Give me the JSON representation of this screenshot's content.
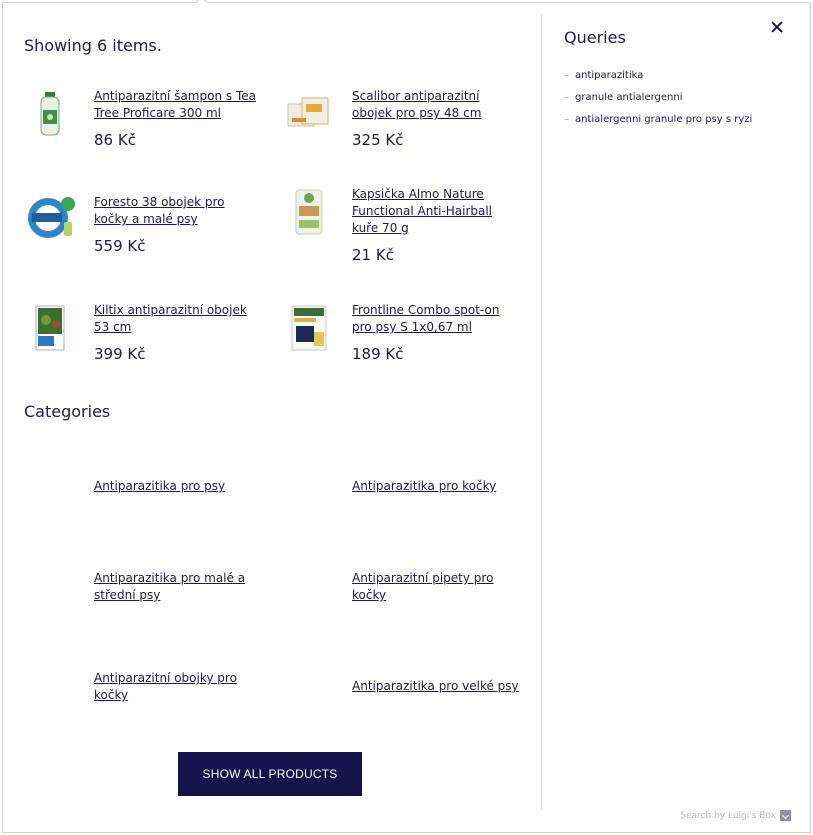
{
  "header": {
    "showing": "Showing 6 items."
  },
  "products": [
    {
      "name": "Antiparazitní šampon s Tea Tree Proficare 300 ml",
      "price": "86 Kč"
    },
    {
      "name": "Scalibor antiparazitní obojek pro psy 48 cm",
      "price": "325 Kč"
    },
    {
      "name": "Foresto 38 obojek pro kočky a malé psy",
      "price": "559 Kč"
    },
    {
      "name": "Kapsička Almo Nature Functional Anti-Hairball kuře 70 g",
      "price": "21 Kč"
    },
    {
      "name": "Kiltix antiparazitní obojek 53 cm",
      "price": "399 Kč"
    },
    {
      "name": "Frontline Combo spot-on pro psy S 1x0,67 ml",
      "price": "189 Kč"
    }
  ],
  "categories": {
    "title": "Categories",
    "items": [
      "Antiparazitika pro psy",
      "Antiparazitika pro kočky",
      "Antiparazitika pro malé a střední psy",
      "Antiparazitní pipety pro kočky",
      "Antiparazitní obojky pro kočky",
      "Antiparazitika pro velké psy"
    ]
  },
  "queries": {
    "title": "Queries",
    "items": [
      "antiparazitika",
      "granule antialergenni",
      "antialergenni granule pro psy s ryzi"
    ]
  },
  "actions": {
    "show_all": "SHOW ALL PRODUCTS"
  },
  "footer": {
    "powered_by": "Search by Luigi's Box"
  },
  "colors": {
    "text": "#1d1952",
    "button": "#16124a",
    "highlight": "#fdf3d9"
  }
}
